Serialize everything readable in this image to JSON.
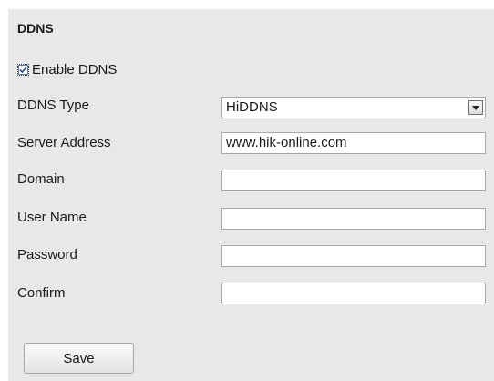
{
  "section": {
    "title": "DDNS"
  },
  "enable": {
    "label": "Enable DDNS",
    "checked": true
  },
  "fields": {
    "ddns_type": {
      "label": "DDNS Type",
      "value": "HiDDNS"
    },
    "server_address": {
      "label": "Server Address",
      "value": "www.hik-online.com"
    },
    "domain": {
      "label": "Domain",
      "value": ""
    },
    "user_name": {
      "label": "User Name",
      "value": ""
    },
    "password": {
      "label": "Password",
      "value": ""
    },
    "confirm": {
      "label": "Confirm",
      "value": ""
    }
  },
  "actions": {
    "save_label": "Save"
  },
  "icons": {
    "checkbox": "checkmark-icon",
    "dropdown": "chevron-down-icon"
  }
}
